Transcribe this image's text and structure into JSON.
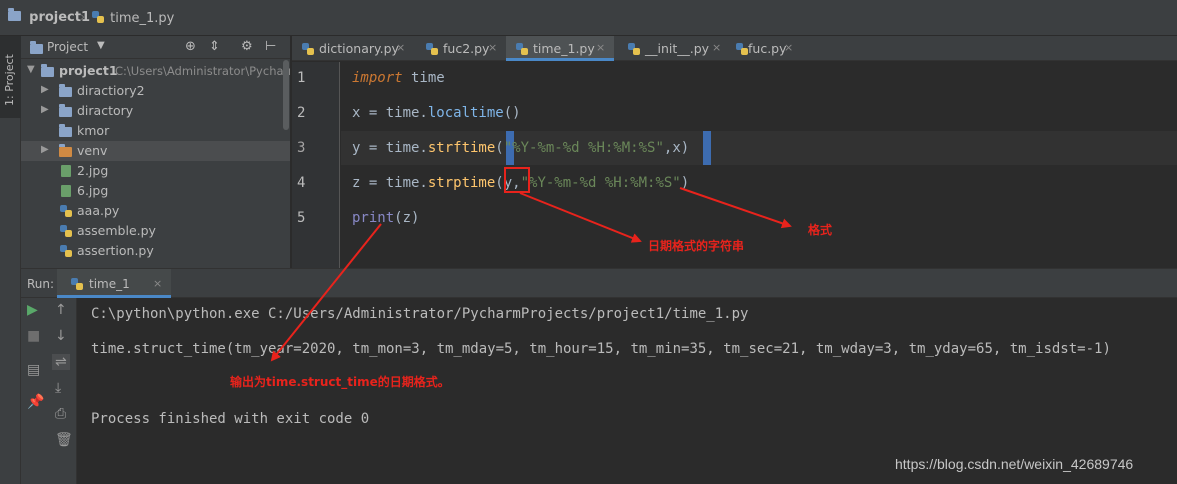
{
  "breadcrumb": {
    "project": "project1",
    "file": "time_1.py"
  },
  "left_stripe": {
    "project_tab": "1: Project"
  },
  "project_panel": {
    "title": "Project",
    "items": [
      {
        "label": "project1",
        "path": "C:\\Users\\Administrator\\Pycharm",
        "kind": "folder",
        "expanded": true
      },
      {
        "label": "diractiory2",
        "kind": "folder"
      },
      {
        "label": "diractory",
        "kind": "folder"
      },
      {
        "label": "kmor",
        "kind": "folder"
      },
      {
        "label": "venv",
        "kind": "folder-excluded"
      },
      {
        "label": "2.jpg",
        "kind": "image"
      },
      {
        "label": "6.jpg",
        "kind": "image"
      },
      {
        "label": "aaa.py",
        "kind": "python"
      },
      {
        "label": "assemble.py",
        "kind": "python"
      },
      {
        "label": "assertion.py",
        "kind": "python"
      }
    ]
  },
  "tabs": [
    {
      "label": "dictionary.py",
      "active": false
    },
    {
      "label": "fuc2.py",
      "active": false
    },
    {
      "label": "time_1.py",
      "active": true
    },
    {
      "label": "__init__.py",
      "active": false
    },
    {
      "label": "fuc.py",
      "active": false
    }
  ],
  "editor": {
    "line_numbers": [
      "1",
      "2",
      "3",
      "4",
      "5"
    ],
    "lines": [
      {
        "import_kw": "import",
        "rest": " time"
      },
      {
        "x": "x = time.",
        "fn": "localtime",
        "tail": "()"
      },
      {
        "pre": "y = time.",
        "fn": "strftime",
        "open": "(",
        "str": "\"%Y-%m-%d %H:%M:%S\"",
        "mid": ",x",
        "close": ")"
      },
      {
        "pre": "z = time.",
        "fn": "strptime",
        "open": "(",
        "arg": "y,",
        "str": "\"%Y-%m-%d %H:%M:%S\"",
        "close": ")"
      },
      {
        "fn": "print",
        "tail": "(z)"
      }
    ]
  },
  "run": {
    "label": "Run:",
    "tab": "time_1",
    "console": [
      "C:\\python\\python.exe C:/Users/Administrator/PycharmProjects/project1/time_1.py",
      "time.struct_time(tm_year=2020, tm_mon=3, tm_mday=5, tm_hour=15, tm_min=35, tm_sec=21, tm_wday=3, tm_yday=65, tm_isdst=-1)",
      "Process finished with exit code 0"
    ]
  },
  "annotations": {
    "date_format_string": "日期格式的字符串",
    "format": "格式",
    "output_note": "输出为time.struct_time的日期格式。"
  },
  "watermark": "https://blog.csdn.net/weixin_42689746",
  "colors": {
    "accent": "#4a88c7",
    "annotation": "#e8231c",
    "keyword": "#cc7832",
    "string": "#6a8759",
    "function": "#ffc66d"
  }
}
